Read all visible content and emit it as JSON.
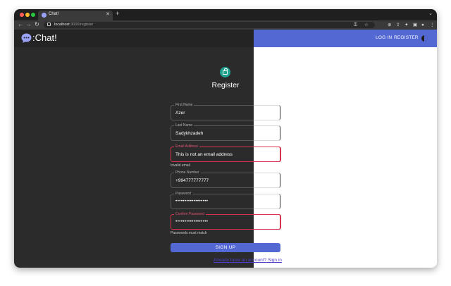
{
  "browser": {
    "tab_title": "Chat!",
    "url_host": "localhost",
    "url_rest": ":3000/register"
  },
  "appbar": {
    "logo_text": ":Chat!",
    "login_label": "LOG IN",
    "register_label": "REGISTER"
  },
  "form": {
    "title": "Register",
    "fields": [
      {
        "label": "First Name",
        "value": "Azer",
        "error": false,
        "helper": ""
      },
      {
        "label": "Last Name",
        "value": "Sadykhzadeh",
        "error": false,
        "helper": ""
      },
      {
        "label": "Email Address",
        "value": "This is not an email address",
        "error": true,
        "helper": "Invalid email"
      },
      {
        "label": "Phone Number",
        "value": "+994777777777",
        "error": false,
        "helper": ""
      },
      {
        "label": "Password",
        "value": "••••••••••••••••••",
        "error": false,
        "helper": ""
      },
      {
        "label": "Confirm Password",
        "value": "••••••••••••••••••",
        "error": true,
        "helper": "Passwords must match"
      }
    ],
    "submit_label": "SIGN UP",
    "signin_text": "Already have an account? Sign in"
  },
  "colors": {
    "primary": "#5468d4",
    "error": "#d63350",
    "avatar": "#1fa28f",
    "dark_bg": "#2b2b2b"
  }
}
